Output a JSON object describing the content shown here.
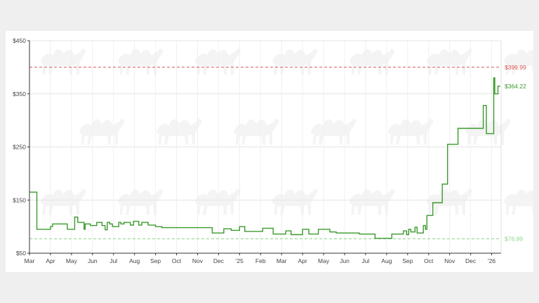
{
  "chart_data": {
    "type": "line",
    "title": "",
    "xlabel": "",
    "ylabel": "",
    "ylim": [
      50,
      450
    ],
    "y_ticks": [
      "$450",
      "$350",
      "$250",
      "$150",
      "$50"
    ],
    "y_tick_values": [
      450,
      350,
      250,
      150,
      50
    ],
    "x_ticks": [
      "Mar",
      "Apr",
      "May",
      "Jun",
      "Jul",
      "Aug",
      "Sep",
      "Oct",
      "Nov",
      "Dec",
      "'25",
      "Feb",
      "Mar",
      "Apr",
      "May",
      "Jun",
      "Jul",
      "Aug",
      "Sep",
      "Oct",
      "Nov",
      "Dec",
      "'26"
    ],
    "x_tick_months": [
      0,
      1,
      2,
      3,
      4,
      5,
      6,
      7,
      8,
      9,
      10,
      11,
      12,
      13,
      14,
      15,
      16,
      17,
      18,
      19,
      20,
      21,
      22
    ],
    "x_range_months": [
      0,
      22.45
    ],
    "grid": true,
    "colors": {
      "price_line": "#3a9a2c",
      "high_line": "#d9534f",
      "low_line": "#8fd48a",
      "grid": "#e4e4e4",
      "watermark": "#f4f4f4"
    },
    "reference_lines": [
      {
        "label": "$399.99",
        "value": 399.99,
        "color": "#d9534f"
      },
      {
        "label": "$76.99",
        "value": 76.99,
        "color": "#8fd48a"
      }
    ],
    "current_label": {
      "label": "$364.22",
      "value": 364.22,
      "color": "#3a9a2c"
    },
    "series": [
      {
        "month": [
          0,
          0.35,
          0.35,
          1.0,
          1.0,
          1.1,
          1.1,
          1.8,
          1.8,
          2.15,
          2.15,
          2.3,
          2.3,
          2.6,
          2.6,
          2.65,
          2.65,
          2.9,
          2.9,
          3.2,
          3.2,
          3.45,
          3.45,
          3.6,
          3.6,
          3.7,
          3.7,
          3.82,
          3.82,
          3.95,
          3.95,
          4.25,
          4.25,
          4.35,
          4.35,
          4.5,
          4.5,
          4.8,
          4.8,
          4.95,
          4.95,
          5.2,
          5.2,
          5.35,
          5.35,
          5.65,
          5.65,
          6.0,
          6.0,
          6.3,
          6.3,
          8.7,
          8.7,
          9.25,
          9.25,
          9.6,
          9.6,
          10.0,
          10.0,
          10.25,
          10.25,
          11.1,
          11.1,
          11.6,
          11.6,
          12.2,
          12.2,
          12.45,
          12.45,
          13.0,
          13.0,
          13.3,
          13.3,
          13.75,
          13.75,
          14.3,
          14.3,
          14.6,
          14.6,
          15.7,
          15.7,
          16.45,
          16.45,
          17.25,
          17.25,
          17.8,
          17.8,
          17.95,
          17.95,
          18.05,
          18.05,
          18.15,
          18.15,
          18.35,
          18.35,
          18.45,
          18.45,
          18.75,
          18.75,
          18.85,
          18.85,
          18.92,
          18.92,
          19.2,
          19.2,
          19.65,
          19.65,
          19.9,
          19.9,
          20.1,
          20.1,
          20.4,
          20.4,
          21.6,
          21.6,
          21.75,
          21.75,
          22.1,
          22.1,
          22.15,
          22.15,
          22.3,
          22.3,
          22.4,
          22.45
        ],
        "value": [
          165,
          165,
          95,
          95,
          100,
          100,
          105,
          105,
          95,
          95,
          118,
          118,
          108,
          108,
          95,
          95,
          105,
          105,
          102,
          102,
          108,
          108,
          102,
          102,
          94,
          94,
          108,
          108,
          105,
          105,
          100,
          100,
          108,
          108,
          105,
          105,
          108,
          108,
          103,
          103,
          110,
          110,
          103,
          103,
          108,
          108,
          103,
          103,
          100,
          100,
          98,
          98,
          88,
          88,
          96,
          96,
          93,
          93,
          100,
          100,
          91,
          91,
          97,
          97,
          86,
          86,
          92,
          92,
          85,
          85,
          95,
          95,
          86,
          86,
          95,
          95,
          90,
          90,
          88,
          88,
          86,
          86,
          78,
          78,
          86,
          86,
          92,
          92,
          85,
          85,
          95,
          95,
          90,
          90,
          99,
          99,
          88,
          88,
          102,
          102,
          95,
          95,
          121,
          121,
          145,
          145,
          180,
          180,
          255,
          255,
          255,
          255,
          285,
          285,
          328,
          328,
          275,
          275,
          380,
          380,
          350,
          350,
          364.22,
          364.22
        ]
      }
    ]
  }
}
